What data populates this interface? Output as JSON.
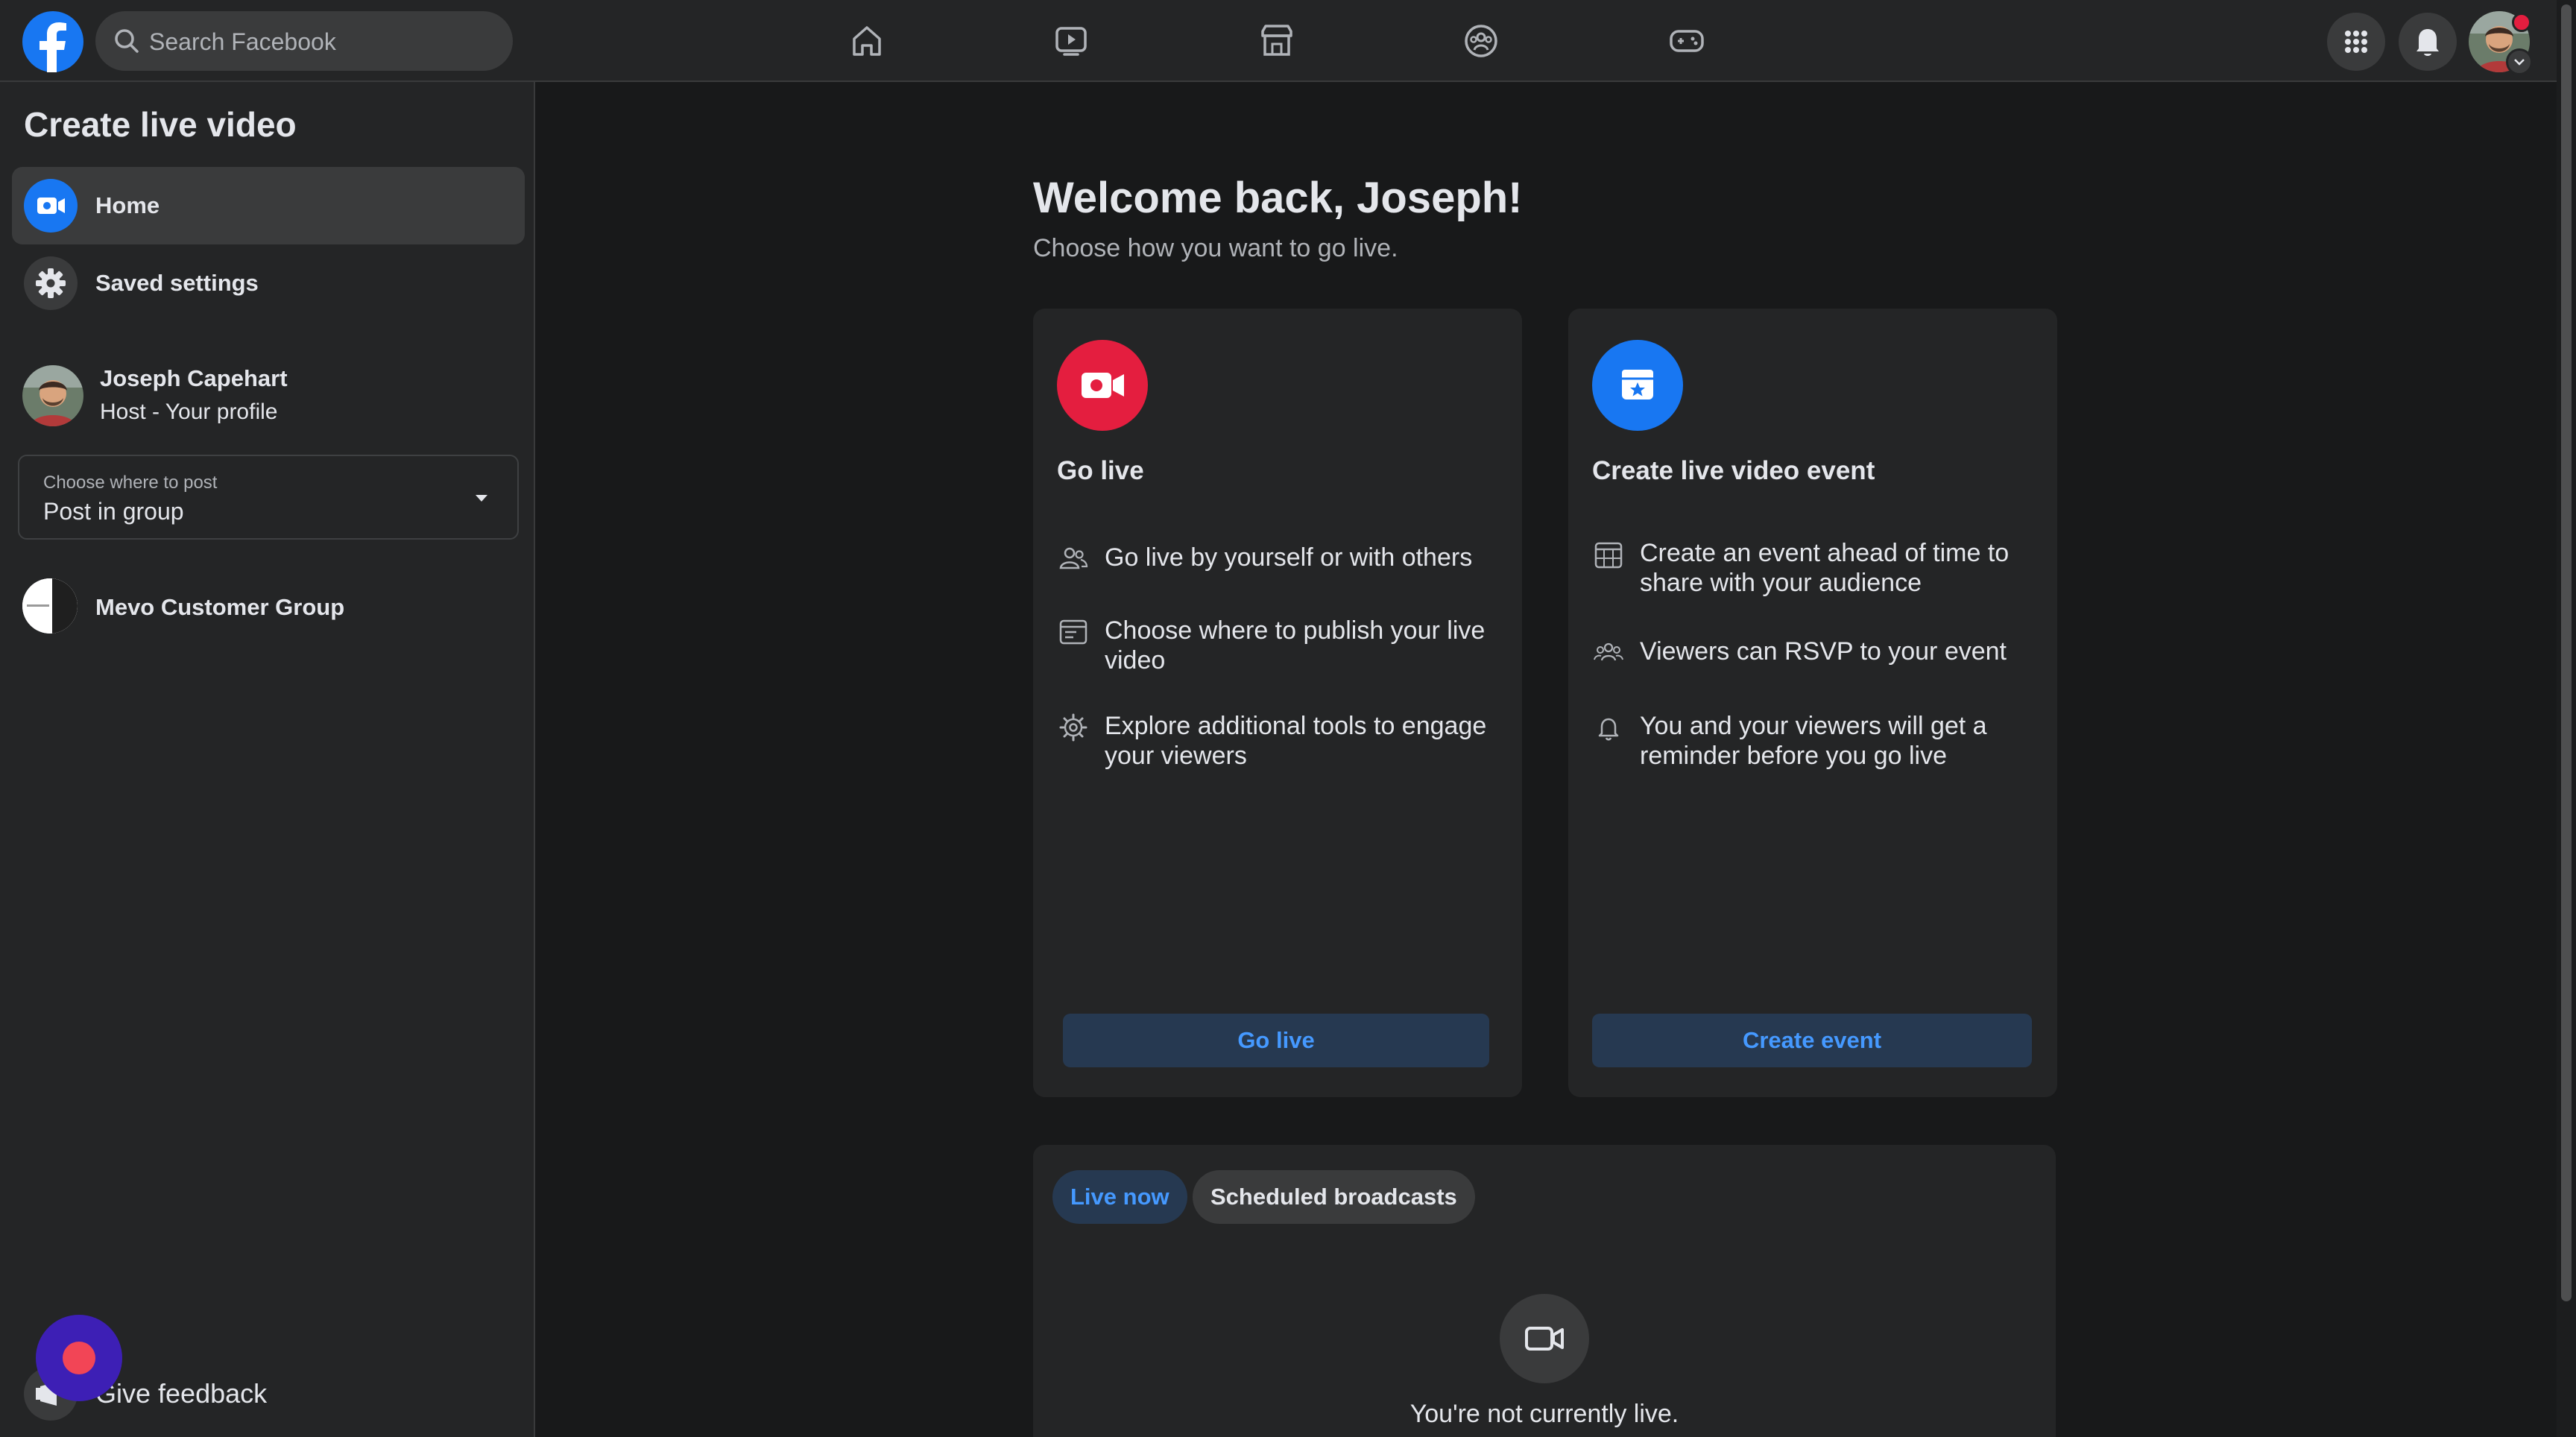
{
  "search": {
    "placeholder": "Search Facebook"
  },
  "sidebar": {
    "title": "Create live video",
    "items": [
      {
        "label": "Home"
      },
      {
        "label": "Saved settings"
      }
    ],
    "host": {
      "name": "Joseph Capehart",
      "role": "Host - Your profile"
    },
    "post_target": {
      "caption": "Choose where to post",
      "value": "Post in group"
    },
    "group": {
      "name": "Mevo Customer Group"
    },
    "feedback_label": "Give feedback"
  },
  "main": {
    "welcome_title": "Welcome back, Joseph!",
    "welcome_subtitle": "Choose how you want to go live.",
    "cards": [
      {
        "title": "Go live",
        "features": [
          "Go live by yourself or with others",
          "Choose where to publish your live video",
          "Explore additional tools to engage your viewers"
        ],
        "button": "Go live"
      },
      {
        "title": "Create live video event",
        "features": [
          "Create an event ahead of time to share with your audience",
          "Viewers can RSVP to your event",
          "You and your viewers will get a reminder before you go live"
        ],
        "button": "Create event"
      }
    ],
    "tabs": [
      "Live now",
      "Scheduled broadcasts"
    ],
    "empty_state": "You're not currently live."
  },
  "colors": {
    "accent": "#1877f2",
    "live_red": "#e41e3f",
    "button_bg": "#263951",
    "button_text": "#4599ff"
  }
}
